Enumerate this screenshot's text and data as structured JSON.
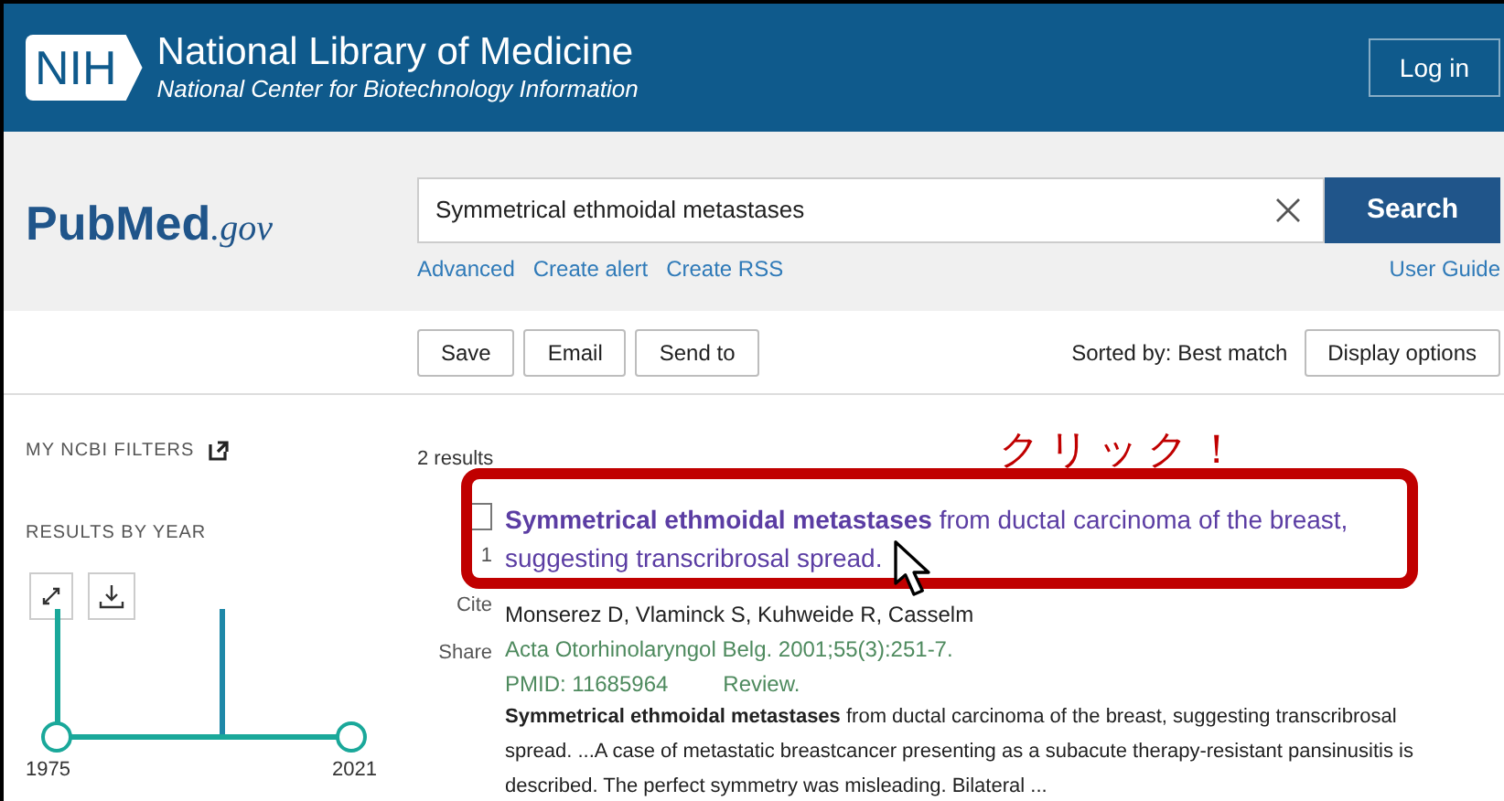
{
  "header": {
    "logo_text": "NIH",
    "title": "National Library of Medicine",
    "subtitle": "National Center for Biotechnology Information",
    "login": "Log in"
  },
  "search": {
    "logo": [
      "Pub",
      "Med",
      ".gov"
    ],
    "query": "Symmetrical ethmoidal metastases",
    "button": "Search",
    "links": [
      "Advanced",
      "Create alert",
      "Create RSS"
    ],
    "user_guide": "User Guide"
  },
  "toolbar": {
    "buttons": [
      "Save",
      "Email",
      "Send to"
    ],
    "sort_label": "Sorted by: Best match",
    "display_button": "Display options"
  },
  "sidebar": {
    "filters_label": "MY NCBI FILTERS",
    "results_by_year": "RESULTS BY YEAR",
    "year_start": "1975",
    "year_end": "2021"
  },
  "results": {
    "count": "2 results",
    "annotation": "クリック！",
    "items": [
      {
        "number": "1",
        "checked": false,
        "title": "**Symmetrical ethmoidal metastases** from ductal carcinoma of the breast, suggesting transcribrosal spread.",
        "actions": [
          "Cite",
          "Share"
        ],
        "authors": "Monserez D, Vlaminck S, Kuhweide R, Casselm",
        "journal": "Acta Otorhinolaryngol Belg. 2001;55(3):251-7.",
        "pmid": "PMID: 11685964",
        "type": "Review.",
        "snippet": "**Symmetrical ethmoidal metastases** from ductal carcinoma of the breast, suggesting transcribrosal spread. ...A case of metastatic breastcancer presenting as a subacute therapy-resistant pansinusitis is described. The perfect symmetry was misleading. Bilateral ..."
      }
    ]
  }
}
